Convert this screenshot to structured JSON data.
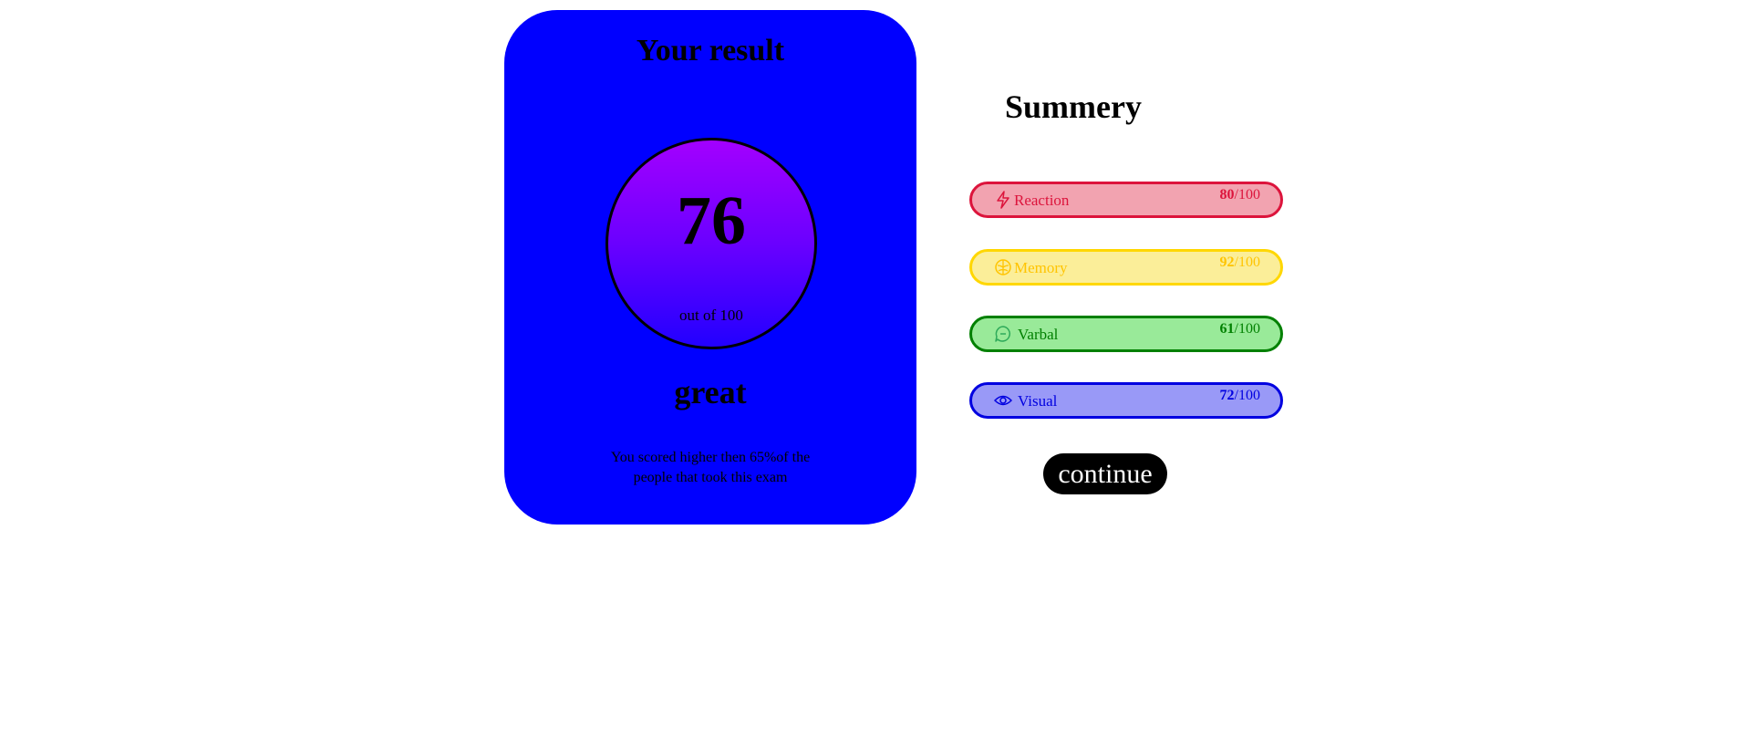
{
  "result": {
    "title": "Your result",
    "score": "76",
    "score_sub": "out of 100",
    "grade": "great",
    "description": "You scored higher then 65%of the people that took this exam"
  },
  "summary": {
    "title": "Summery",
    "items": [
      {
        "label": "Reaction",
        "score": "80",
        "max": "/100",
        "icon": "lightning-icon",
        "color": "#dc143c",
        "bg": "#f2a3b0"
      },
      {
        "label": "Memory",
        "score": "92",
        "max": "/100",
        "icon": "brain-icon",
        "color": "#ffd700",
        "bg": "#fbee99"
      },
      {
        "label": "Varbal",
        "score": "61",
        "max": "/100",
        "icon": "chat-bubble-icon",
        "color": "#008000",
        "bg": "#99ea99"
      },
      {
        "label": "Visual",
        "score": "72",
        "max": "/100",
        "icon": "eye-icon",
        "color": "#0000e0",
        "bg": "#9999f7"
      }
    ]
  },
  "continue_label": "continue",
  "colors": {
    "card": "#0000ff",
    "circle_top": "#a300ff",
    "circle_bottom": "#2200ff"
  }
}
